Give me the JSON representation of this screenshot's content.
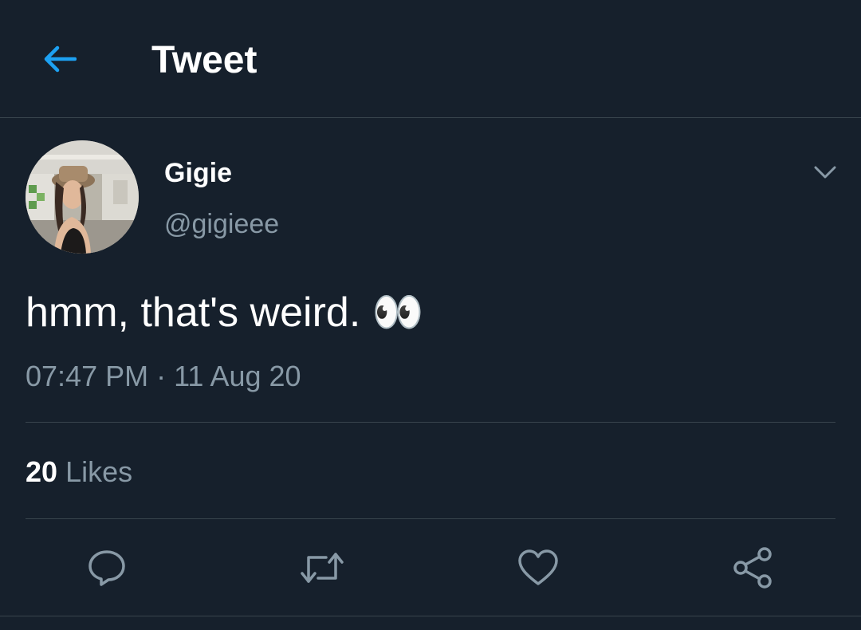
{
  "header": {
    "back_icon": "arrow-left-icon",
    "title": "Tweet"
  },
  "tweet": {
    "author": {
      "display_name": "Gigie",
      "handle": "@gigieee",
      "avatar_icon": "profile-photo"
    },
    "text": "hmm, that's weird. 👀",
    "timestamp": "07:47 PM · 11 Aug 20",
    "likes_count": "20",
    "likes_label": "Likes",
    "more_icon": "chevron-down-icon"
  },
  "actions": [
    {
      "name": "reply",
      "icon": "reply-icon"
    },
    {
      "name": "retweet",
      "icon": "retweet-icon"
    },
    {
      "name": "like",
      "icon": "heart-icon"
    },
    {
      "name": "share",
      "icon": "share-icon"
    }
  ],
  "colors": {
    "background": "#16202c",
    "accent": "#1da1f2",
    "text_primary": "#ffffff",
    "text_secondary": "#8899a6",
    "divider": "#38444d"
  }
}
